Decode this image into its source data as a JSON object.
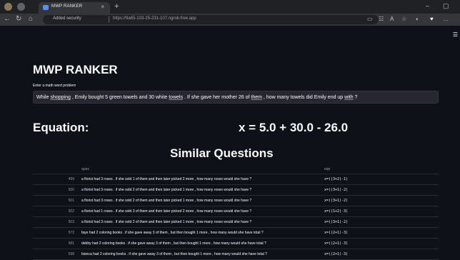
{
  "browser": {
    "tab_title": "MWP RANKER",
    "tab_close": "×",
    "new_tab": "+",
    "security_label": "Added security",
    "url": "https://9a65-103-25-231-107.ngrok-free.app",
    "minimize": "–",
    "maximize": "▢"
  },
  "app": {
    "title": "MWP RANKER",
    "input_label": "Enter a math word problem",
    "input_segments": [
      {
        "text": "While ",
        "u": false
      },
      {
        "text": "shopping",
        "u": true
      },
      {
        "text": " , Emily bought 5 green towels and 30 white ",
        "u": false
      },
      {
        "text": "towels",
        "u": true
      },
      {
        "text": " . If she gave her mother 26 of ",
        "u": false
      },
      {
        "text": "them",
        "u": true
      },
      {
        "text": " , how many towels did Emily end up ",
        "u": false
      },
      {
        "text": "with",
        "u": true
      },
      {
        "text": " ?",
        "u": false
      }
    ],
    "equation_label": "Equation:",
    "equation_value": "x = 5.0 + 30.0 - 26.0",
    "similar_title": "Similar Questions",
    "table": {
      "headers": [
        "",
        "ques",
        "eqn"
      ],
      "rows": [
        {
          "idx": "499",
          "ques": "a florist had 3 roses . if she sold 1 of them and then later picked 2 more , how many roses would she have ?",
          "eqn": "x=((3+2)-1)"
        },
        {
          "idx": "500",
          "ques": "a florist had 3 roses . if she sold 2 of them and then later picked 1 more , how many roses would she have ?",
          "eqn": "x=((3+1)-2)"
        },
        {
          "idx": "501",
          "ques": "a florist had 3 roses . if she sold 2 of them and then later picked 1 more , how many roses would she have ?",
          "eqn": "x=((3+1)-2)"
        },
        {
          "idx": "502",
          "ques": "a florist had 1 roses . if she sold 3 of them and then later picked 2 more , how many roses would she have ?",
          "eqn": "x=((1+2)-3)"
        },
        {
          "idx": "503",
          "ques": "a florist had 3 roses . if she sold 2 of them and then later picked 1 more , how many roses would she have ?",
          "eqn": "x=((3+1)-2)"
        },
        {
          "idx": "572",
          "ques": "faye had 2 coloring books . if she gave away 3 of them , but then bought 1 more , how many would she have total ?",
          "eqn": "x=((2+1)-3)"
        },
        {
          "idx": "581",
          "ques": "debby had 2 coloring books . if she gave away 3 of them , but then bought 1 more , how many would she have total ?",
          "eqn": "x=((2+1)-3)"
        },
        {
          "idx": "598",
          "ques": "bianca had 2 coloring books . if she gave away 3 of them , but then bought 1 more , how many would she have total ?",
          "eqn": "x=((2+1)-3)"
        }
      ]
    }
  }
}
